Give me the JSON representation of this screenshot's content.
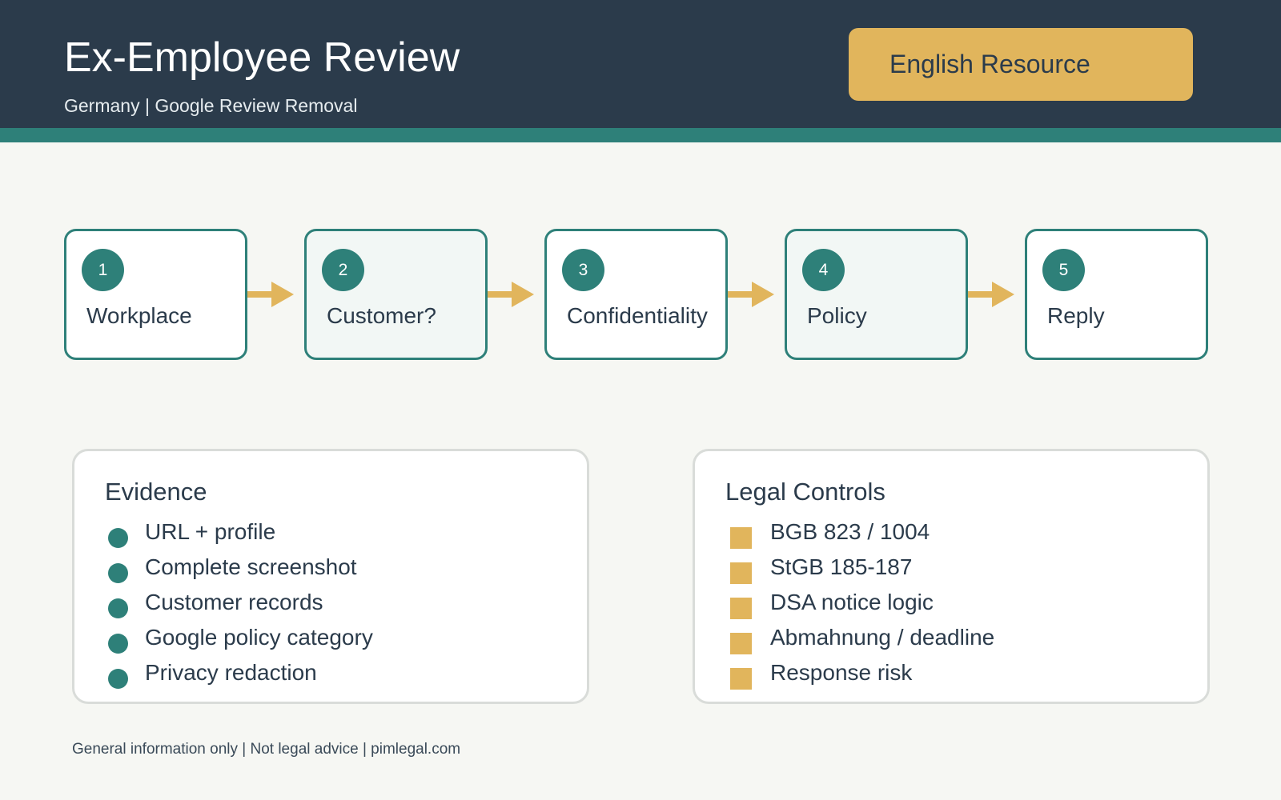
{
  "header": {
    "title": "Ex-Employee Review",
    "subtitle": "Germany | Google Review Removal",
    "badge": "English Resource"
  },
  "steps": [
    {
      "number": "1",
      "label": "Workplace"
    },
    {
      "number": "2",
      "label": "Customer?"
    },
    {
      "number": "3",
      "label": "Confidentiality"
    },
    {
      "number": "4",
      "label": "Policy"
    },
    {
      "number": "5",
      "label": "Reply"
    }
  ],
  "evidence": {
    "title": "Evidence",
    "items": [
      "URL + profile",
      "Complete screenshot",
      "Customer records",
      "Google policy category",
      "Privacy redaction"
    ]
  },
  "legal": {
    "title": "Legal Controls",
    "items": [
      "BGB 823 / 1004",
      "StGB 185-187",
      "DSA notice logic",
      "Abmahnung / deadline",
      "Response risk"
    ]
  },
  "footer": "General information only | Not legal advice | pimlegal.com",
  "colors": {
    "navy": "#2b3b4b",
    "teal": "#2e8079",
    "gold": "#e1b55c",
    "background": "#f6f7f3"
  }
}
